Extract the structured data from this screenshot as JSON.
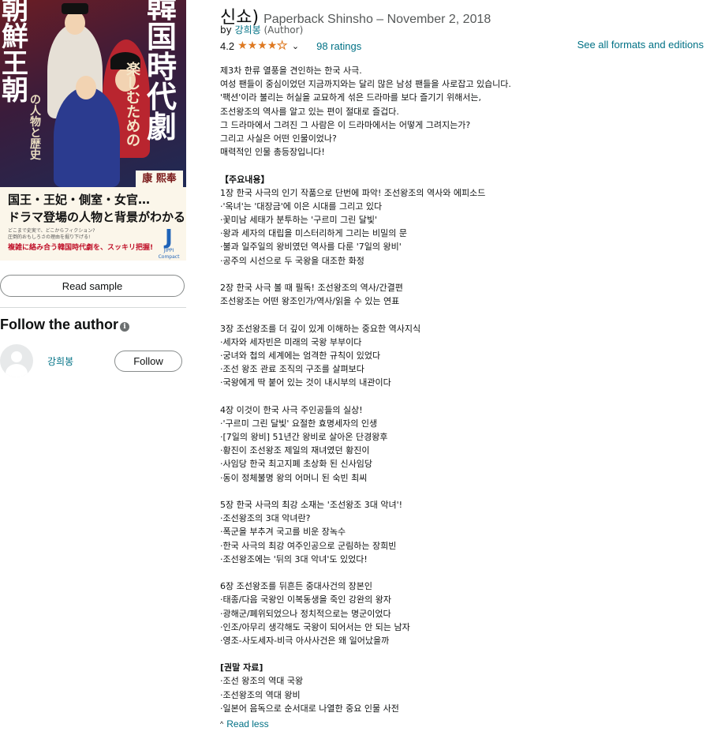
{
  "cover": {
    "title_col1": [
      "朝",
      "鮮",
      "王",
      "朝"
    ],
    "title_col2": [
      "韓",
      "国",
      "時",
      "代",
      "劇"
    ],
    "subtitle_col": [
      "楽",
      "し",
      "む",
      "た",
      "め",
      "の"
    ],
    "subtitle_col2": [
      "の",
      "人",
      "物",
      "と",
      "歴",
      "史"
    ],
    "author": "康 熙奉",
    "line1": "国王・王妃・側室・女官…",
    "line2": "ドラマ登場の人物と背景がわかる!",
    "line3": "どこまで史実で、どこからフィクション?",
    "line4": "圧倒的おもしろさの理由を掘り下げる!",
    "line5": "複雑に絡み合う韓国時代劇を、スッキリ把握!",
    "publisher_mark": "J",
    "publisher_name": "JIPPI Compact"
  },
  "read_sample_label": "Read sample",
  "follow": {
    "title": "Follow the author",
    "info_glyph": "i",
    "author_name": "강희봉",
    "follow_label": "Follow"
  },
  "product": {
    "title_tail": "신쇼)",
    "format_line": "Paperback Shinsho – November 2, 2018",
    "by_label": "by",
    "author": "강희봉",
    "author_role": "(Author)",
    "rating": "4.2",
    "rating_value": 4.2,
    "ratings_count": "98 ratings",
    "see_all": "See all formats and editions",
    "chevron": "⌄"
  },
  "description": [
    {
      "text": "제3차 한류 열풍을 견인하는 한국 사극."
    },
    {
      "text": "여성 팬들이 중심이었던 지금까지와는 달리 많은 남성 팬들을 사로잡고 있습니다."
    },
    {
      "text": "'팩션'이라 불리는 허실을 교묘하게 섞은 드라마를 보다 즐기기 위해서는,"
    },
    {
      "text": "조선왕조의 역사를 알고 있는 편이 절대로 즐겁다."
    },
    {
      "text": "그 드라마에서 그려진 그 사람은 이 드라마에서는 어떻게 그려지는가?"
    },
    {
      "text": "그리고 사실은 어떤 인물이었나?"
    },
    {
      "text": "매력적인 인물 총등장입니다!"
    },
    {
      "text": ""
    },
    {
      "text": "【주요내용】",
      "bold": true
    },
    {
      "text": "1장 한국 사극의 인기 작품으로 단번에 파악! 조선왕조의 역사와 에피소드"
    },
    {
      "text": "·'옥녀'는 '대장금'에 이은 시대를 그리고 있다"
    },
    {
      "text": "·꽃미남 세태가 분투하는 '구르미 그린 달빛'"
    },
    {
      "text": "·왕과 세자의 대립을 미스터리하게 그리는 비밀의 문"
    },
    {
      "text": "·불과 일주일의 왕비였던 역사를 다룬 '7일의 왕비'"
    },
    {
      "text": "·공주의 시선으로 두 국왕을 대조한 화정"
    },
    {
      "text": ""
    },
    {
      "text": "2장 한국 사극 볼 때 필독! 조선왕조의 역사/간결편"
    },
    {
      "text": "조선왕조는 어떤 왕조인가/역사/읽을 수 있는 연표"
    },
    {
      "text": ""
    },
    {
      "text": "3장 조선왕조를 더 깊이 있게 이해하는 중요한 역사지식"
    },
    {
      "text": "·세자와 세자빈은 미래의 국왕 부부이다"
    },
    {
      "text": "·궁녀와 첩의 세계에는 엄격한 규칙이 있었다"
    },
    {
      "text": "·조선 왕조 관료 조직의 구조를 살펴보다"
    },
    {
      "text": "·국왕에게 딱 붙어 있는 것이 내시부의 내관이다"
    },
    {
      "text": ""
    },
    {
      "text": "4장 이것이 한국 사극 주인공들의 실상!"
    },
    {
      "text": "·'구르미 그린 달빛' 요절한 효명세자의 인생"
    },
    {
      "text": "·[7일의 왕비] 51년간 왕비로 살아온 단경왕후"
    },
    {
      "text": "·황진이 조선왕조 제일의 재녀였던 황진이"
    },
    {
      "text": "·사임당 한국 최고지폐 초상화 된 신사임당"
    },
    {
      "text": "·동이 정체불명 왕의 어머니 된 숙빈 최씨"
    },
    {
      "text": ""
    },
    {
      "text": "5장 한국 사극의 최강 소재는 '조선왕조 3대 악녀'!"
    },
    {
      "text": "·조선왕조의 3대 악녀란?"
    },
    {
      "text": "·폭군을 부추겨 국고를 비운 장녹수"
    },
    {
      "text": "·한국 사극의 최강 여주인공으로 군림하는 장희빈"
    },
    {
      "text": "·조선왕조에는 '뒤의 3대 악녀'도 있었다!"
    },
    {
      "text": ""
    },
    {
      "text": "6장 조선왕조를 뒤흔든 중대사건의 장본인"
    },
    {
      "text": "·태종/다음 국왕인 이복동생을 죽인 강완의 왕자"
    },
    {
      "text": "·광해군/폐위되었으나 정치적으로는 명군이었다"
    },
    {
      "text": "·인조/아무리 생각해도 국왕이 되어서는 안 되는 남자"
    },
    {
      "text": "·영조-사도세자-비극 아사사건은 왜 일어났을까"
    },
    {
      "text": ""
    },
    {
      "text": "[권말 자료]",
      "bold": true
    },
    {
      "text": "·조선 왕조의 역대 국왕"
    },
    {
      "text": "·조선왕조의 역대 왕비"
    },
    {
      "text": "·일본어 음독으로 순서대로 나열한 중요 인물 사전"
    }
  ],
  "read_less": {
    "caret": "^",
    "label": "Read less"
  },
  "colors": {
    "link": "#007185",
    "star": "#de7921",
    "text": "#0f1111",
    "muted": "#565959"
  }
}
